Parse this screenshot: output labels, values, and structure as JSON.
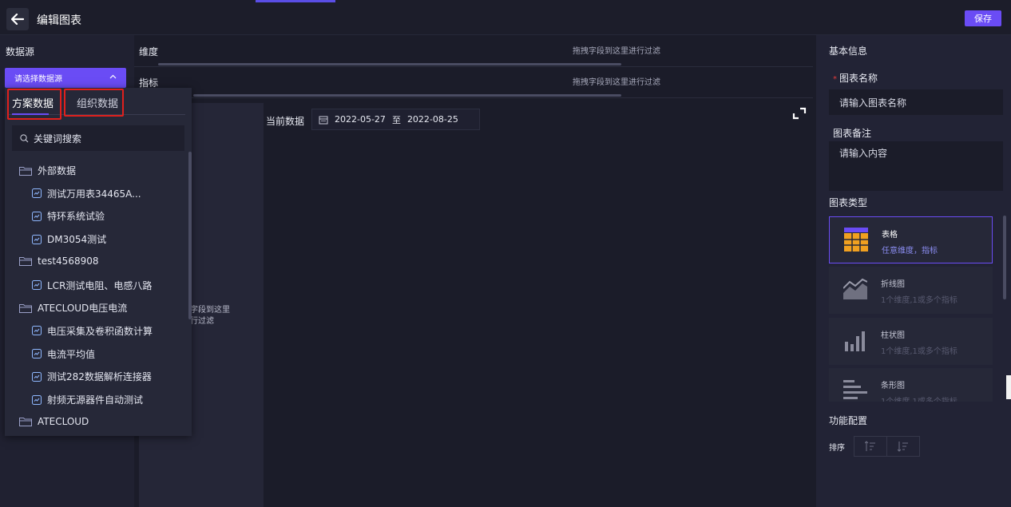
{
  "header": {
    "title": "编辑图表",
    "save_label": "保存"
  },
  "datasource": {
    "title": "数据源",
    "placeholder": "请选择数据源"
  },
  "zones": {
    "dimension_label": "维度",
    "metric_label": "指标",
    "drop_hint": "拖拽字段到这里进行过滤",
    "column_hint_line1": "字段到这里",
    "column_hint_line2": "行过滤"
  },
  "current_data": {
    "label": "当前数据",
    "start": "2022-05-27",
    "to": "至",
    "end": "2022-08-25"
  },
  "dropdown": {
    "tabs": [
      "方案数据",
      "组织数据"
    ],
    "search_placeholder": "关键词搜索",
    "tree": [
      {
        "type": "folder",
        "label": "外部数据"
      },
      {
        "type": "file",
        "label": "测试万用表34465A..."
      },
      {
        "type": "file",
        "label": "特环系统试验"
      },
      {
        "type": "file",
        "label": "DM3054测试"
      },
      {
        "type": "folder",
        "label": "test4568908"
      },
      {
        "type": "file",
        "label": "LCR测试电阻、电感八路"
      },
      {
        "type": "folder",
        "label": "ATECLOUD电压电流"
      },
      {
        "type": "file",
        "label": "电压采集及卷积函数计算"
      },
      {
        "type": "file",
        "label": "电流平均值"
      },
      {
        "type": "file",
        "label": "测试282数据解析连接器"
      },
      {
        "type": "file",
        "label": "射频无源器件自动测试"
      },
      {
        "type": "folder",
        "label": "ATECLOUD"
      }
    ]
  },
  "right_panel": {
    "basic_info": "基本信息",
    "chart_name_label": "图表名称",
    "chart_name_placeholder": "请输入图表名称",
    "chart_note_label": "图表备注",
    "chart_note_placeholder": "请输入内容",
    "chart_type_label": "图表类型",
    "chart_types": [
      {
        "name": "表格",
        "desc": "任意维度，指标"
      },
      {
        "name": "折线图",
        "desc": "1个维度,1或多个指标"
      },
      {
        "name": "柱状图",
        "desc": "1个维度,1或多个指标"
      },
      {
        "name": "条形图",
        "desc": "1个维度,1或多个指标"
      }
    ],
    "func_config_label": "功能配置",
    "sort_label": "排序"
  },
  "colors": {
    "accent": "#6a4cf5",
    "highlight_box": "#e0201d",
    "background": "#1e1f2c"
  },
  "icons": [
    "back-arrow-icon",
    "caret-up-icon",
    "calendar-icon",
    "expand-icon",
    "search-icon",
    "folder-icon",
    "file-chart-icon",
    "table-icon",
    "line-chart-icon",
    "bar-chart-icon",
    "hbar-chart-icon",
    "sort-asc-icon",
    "sort-desc-icon"
  ]
}
